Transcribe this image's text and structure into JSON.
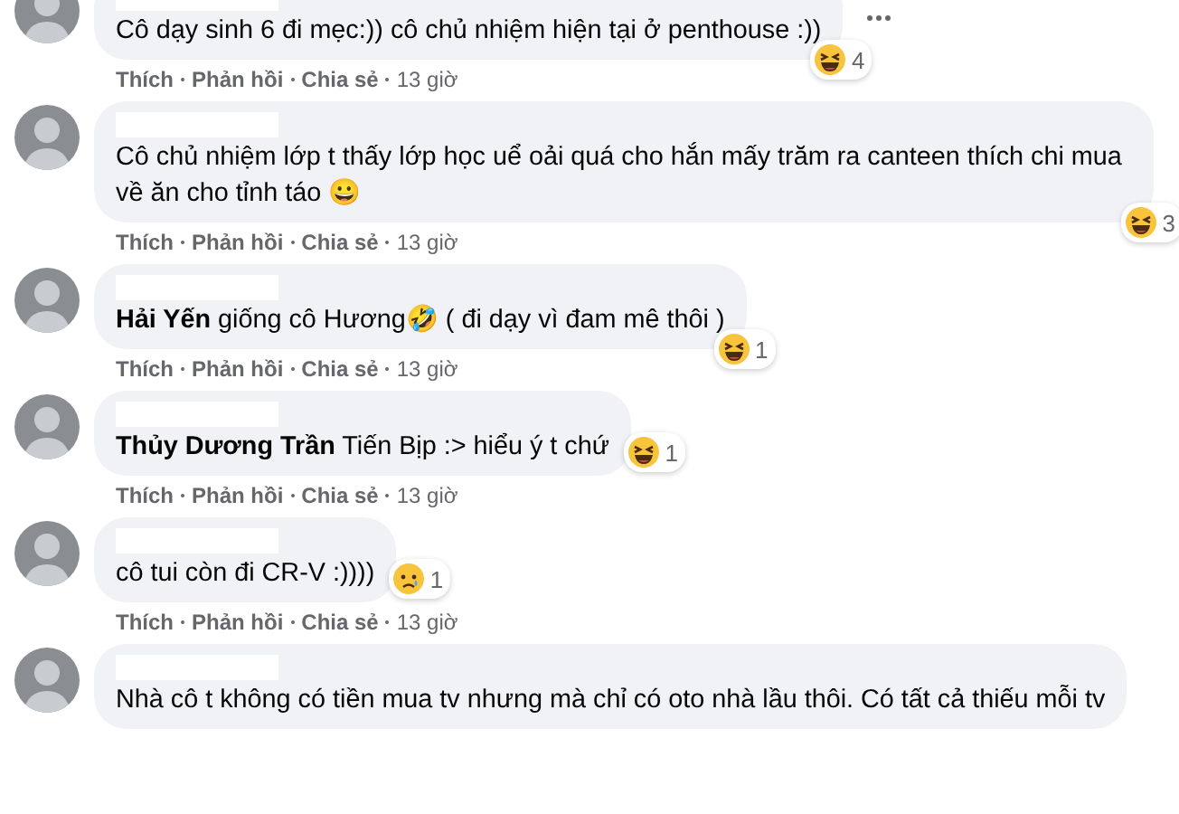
{
  "comments": [
    {
      "text": "Cô dạy sinh 6 đi mẹc:)) cô chủ nhiệm hiện tại ở penthouse :))",
      "reaction": {
        "kind": "haha",
        "count": "4"
      },
      "menu": true,
      "actions": [
        "Thích",
        "Phản hồi",
        "Chia sẻ"
      ],
      "time": "13 giờ"
    },
    {
      "text": "Cô chủ nhiệm lớp t thấy lớp học uể oải quá cho hắn mấy trăm ra canteen thích chi mua về ăn cho tỉnh táo 😀",
      "reaction": {
        "kind": "haha",
        "count": "3"
      },
      "actions": [
        "Thích",
        "Phản hồi",
        "Chia sẻ"
      ],
      "time": "13 giờ"
    },
    {
      "text": "**Hải Yến** giống cô Hương🤣 ( đi dạy vì đam mê thôi )",
      "reaction": {
        "kind": "haha",
        "count": "1"
      },
      "actions": [
        "Thích",
        "Phản hồi",
        "Chia sẻ"
      ],
      "time": "13 giờ"
    },
    {
      "text": "**Thủy Dương Trần** Tiến Bịp :> hiểu ý t chứ",
      "reaction": {
        "kind": "haha",
        "count": "1"
      },
      "actions": [
        "Thích",
        "Phản hồi",
        "Chia sẻ"
      ],
      "time": "13 giờ"
    },
    {
      "text": "cô tui còn đi CR-V :))))",
      "reaction": {
        "kind": "sad",
        "count": "1"
      },
      "actions": [
        "Thích",
        "Phản hồi",
        "Chia sẻ"
      ],
      "time": "13 giờ"
    },
    {
      "text": "Nhà cô t không có tiền mua tv nhưng mà chỉ có oto nhà lầu thôi. Có tất cả thiếu mỗi tv"
    }
  ]
}
